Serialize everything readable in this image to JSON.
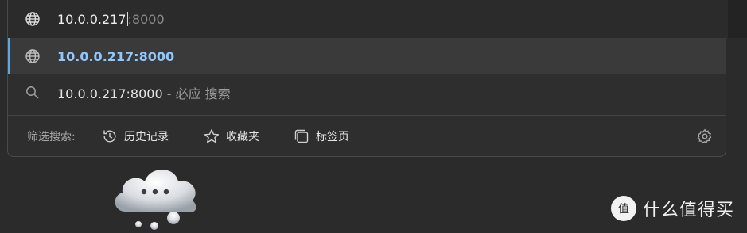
{
  "address_bar": {
    "typed_text": "10.0.0.217",
    "autocomplete_suffix": ":8000"
  },
  "suggestions": [
    {
      "icon": "globe-icon",
      "text": "10.0.0.217:8000",
      "selected": true
    },
    {
      "icon": "search-icon",
      "text": "10.0.0.217:8000",
      "engine_suffix": " - 必应 搜索",
      "selected": false
    }
  ],
  "filters": {
    "label": "筛选搜索:",
    "items": [
      {
        "icon": "history-icon",
        "label": "历史记录"
      },
      {
        "icon": "star-icon",
        "label": "收藏夹"
      },
      {
        "icon": "tabs-icon",
        "label": "标签页"
      }
    ],
    "settings_icon": "gear-icon"
  },
  "watermark": {
    "text": "什么值得买",
    "logo_text": "值"
  },
  "colors": {
    "background": "#2b2b2b",
    "selected_row": "#3a3a3a",
    "accent": "#5aa9e6",
    "selected_text": "#8fc8ff"
  }
}
